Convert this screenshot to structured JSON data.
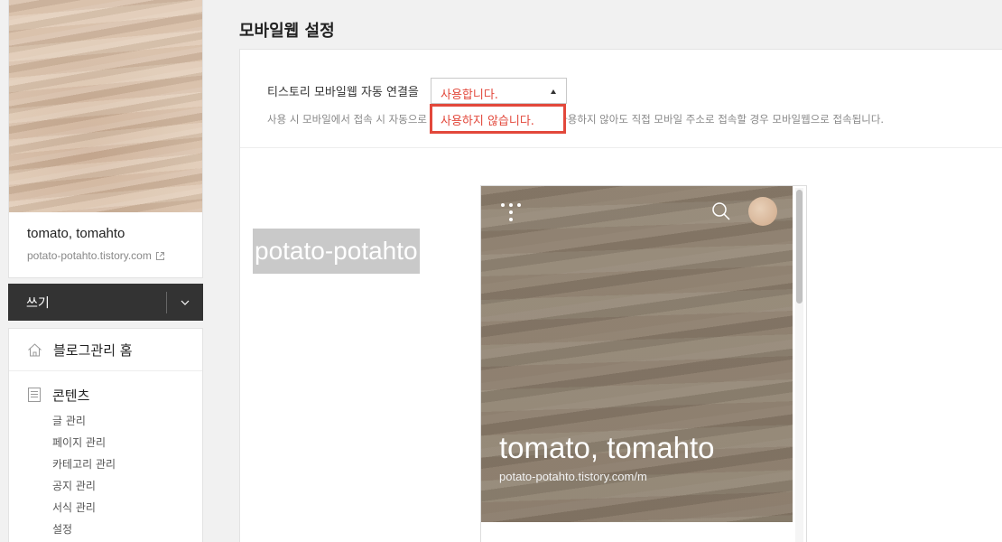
{
  "sidebar": {
    "blog_name": "tomato, tomahto",
    "blog_url": "potato-potahto.tistory.com",
    "write_label": "쓰기",
    "menu": {
      "home_label": "블로그관리 홈",
      "content_label": "콘텐츠",
      "content_items": [
        "글 관리",
        "페이지 관리",
        "카테고리 관리",
        "공지 관리",
        "서식 관리",
        "설정"
      ]
    }
  },
  "main": {
    "title": "모바일웹 설정",
    "setting_label": "티스토리 모바일웹 자동 연결을",
    "select_value": "사용합니다.",
    "dropdown_option": "사용하지 않습니다.",
    "help_text": "사용 시 모바일에서 접속 시 자동으로 모바일웹 주소로 연결됩니다. 사용하지 않아도 직접 모바일 주소로 접속할 경우 모바일웹으로 접속됩니다.",
    "name_tag": "potato-potahto",
    "preview": {
      "blog_name": "tomato, tomahto",
      "blog_url": "potato-potahto.tistory.com/m"
    }
  },
  "colors": {
    "accent_red": "#e2483b",
    "write_bar": "#333333"
  },
  "icons": [
    "external-link-icon",
    "chevron-down-icon",
    "home-icon",
    "document-icon",
    "tistory-logo-icon",
    "search-icon",
    "caret-up-icon"
  ]
}
